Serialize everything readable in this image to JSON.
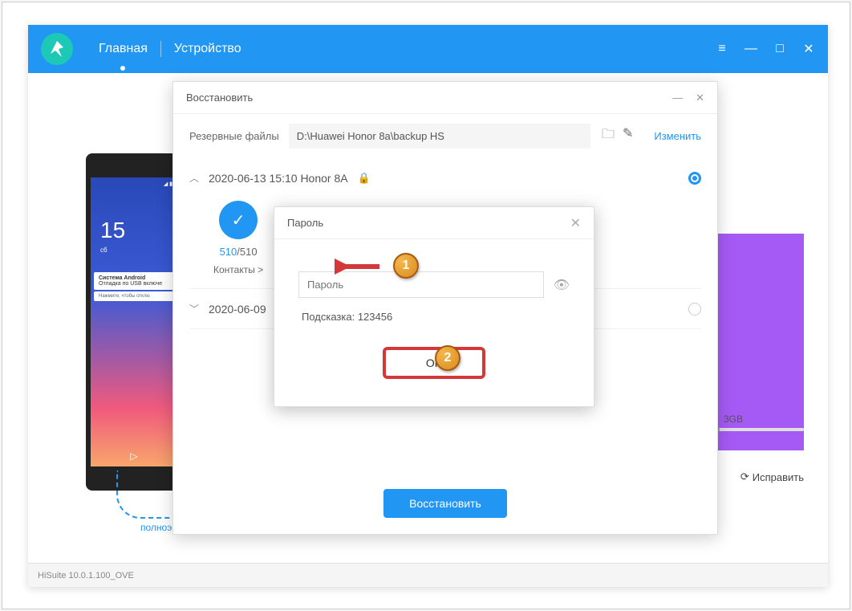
{
  "nav": {
    "home": "Главная",
    "device": "Устройство"
  },
  "phone": {
    "time_partial": "15",
    "notif_title": "Система Android",
    "notif_body": "Отладка по USB включе",
    "notif_sub": "Нажмите, чтобы отклю"
  },
  "sidebar": {
    "storage_suffix": "3GB",
    "fix": "Исправить",
    "fullscreen": "полноэкранной"
  },
  "restore_dialog": {
    "title": "Восстановить",
    "backup_files_label": "Резервные файлы",
    "path_value": "D:\\Huawei Honor 8a\\backup HS",
    "change": "Изменить",
    "items": [
      {
        "date": "2020-06-13 15:10 Honor 8A",
        "selected": true,
        "expanded": true
      },
      {
        "date": "2020-06-09",
        "selected": false,
        "expanded": false
      }
    ],
    "details": {
      "count_selected": "510",
      "count_total": "/510",
      "label": "Контакты >"
    },
    "button": "Восстановить"
  },
  "password_dialog": {
    "title": "Пароль",
    "placeholder": "Пароль",
    "hint": "Подсказка: 123456",
    "ok": "OK"
  },
  "annotations": {
    "badge1": "1",
    "badge2": "2"
  },
  "footer": {
    "version": "HiSuite 10.0.1.100_OVE"
  }
}
